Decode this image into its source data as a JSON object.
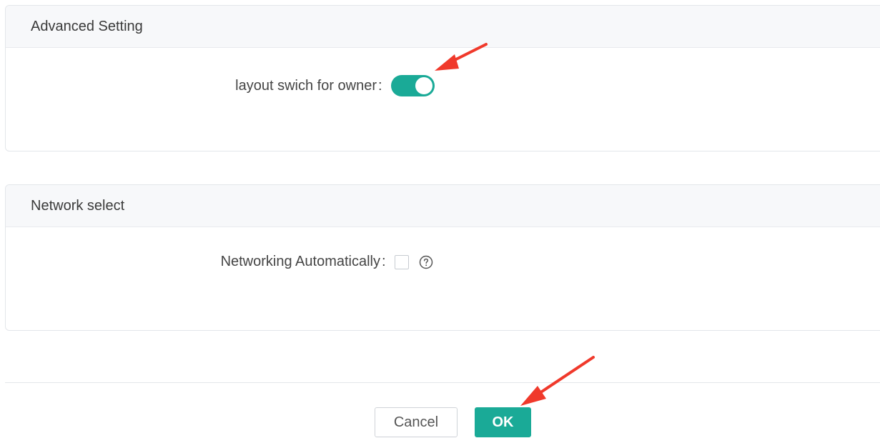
{
  "advanced_setting": {
    "title": "Advanced Setting",
    "layout_switch": {
      "label": "layout swich for owner",
      "colon": ":",
      "state": "on"
    }
  },
  "network_select": {
    "title": "Network select",
    "networking_automatically": {
      "label": "Networking Automatically",
      "colon": ":",
      "checked": false,
      "help_icon": "question-circle-icon"
    }
  },
  "footer": {
    "cancel_label": "Cancel",
    "ok_label": "OK"
  },
  "colors": {
    "accent": "#1aaa97",
    "annotation_arrow": "#f0392b"
  }
}
